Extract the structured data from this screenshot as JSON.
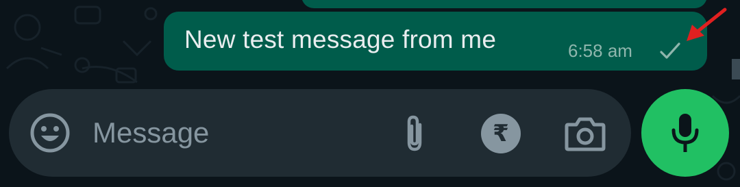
{
  "chat": {
    "previous_message": {
      "text": ""
    },
    "last_message": {
      "text": "New test message from me",
      "time": "6:58 am",
      "status_icon": "single-check-icon",
      "status": "sent"
    }
  },
  "composer": {
    "placeholder": "Message",
    "value": "",
    "emoji_icon": "emoji-icon",
    "attach_icon": "paperclip-icon",
    "payment_symbol": "₹",
    "camera_icon": "camera-icon"
  },
  "send": {
    "icon": "microphone-icon"
  },
  "colors": {
    "background": "#0b141a",
    "outgoing_bubble": "#005c4b",
    "composer_bg": "#202c33",
    "icon_gray": "#8696a0",
    "mic_green": "#21c063",
    "annotation_red": "#e02020"
  }
}
